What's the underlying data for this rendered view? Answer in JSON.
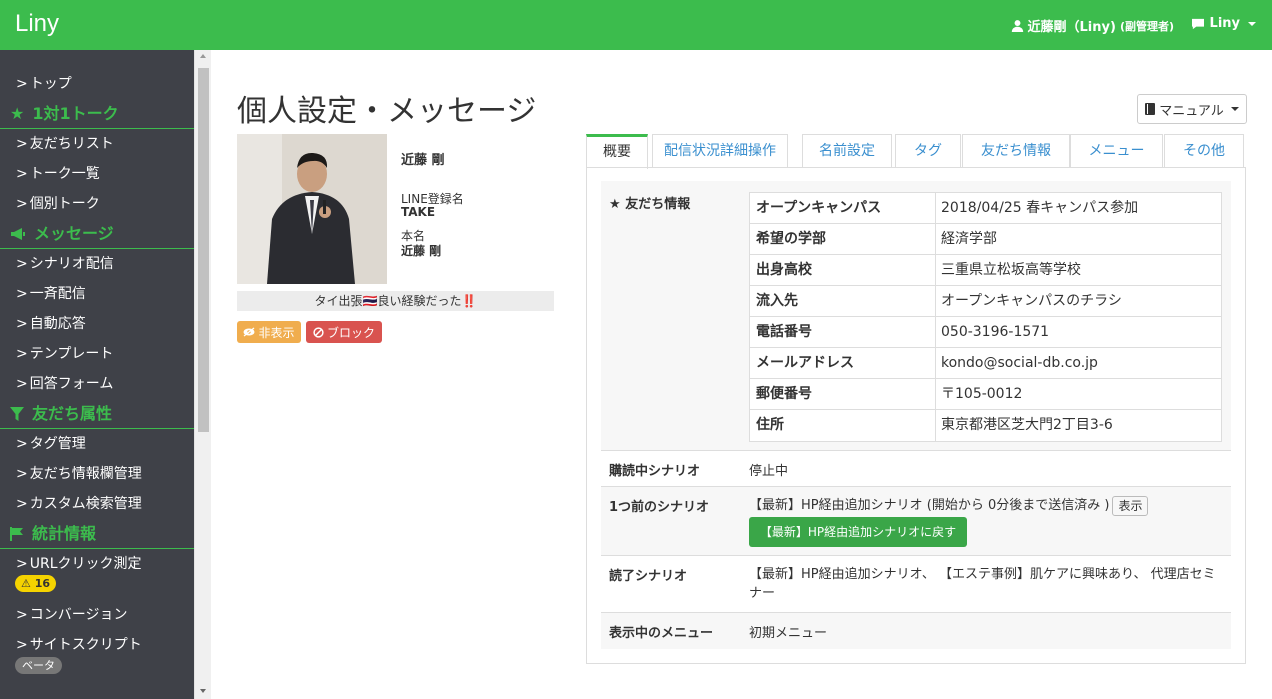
{
  "header": {
    "brand": "Liny",
    "user": "近藤剛（Liny)",
    "role": "(副管理者)",
    "menu_label": "Liny"
  },
  "sidebar": {
    "top": "トップ",
    "sections": [
      {
        "title": "1対1トーク",
        "icon": "star-icon",
        "items": [
          "友だちリスト",
          "トーク一覧",
          "個別トーク"
        ]
      },
      {
        "title": "メッセージ",
        "icon": "megaphone-icon",
        "items": [
          "シナリオ配信",
          "一斉配信",
          "自動応答",
          "テンプレート",
          "回答フォーム"
        ]
      },
      {
        "title": "友だち属性",
        "icon": "filter-icon",
        "items": [
          "タグ管理",
          "友だち情報欄管理",
          "カスタム検索管理"
        ]
      },
      {
        "title": "統計情報",
        "icon": "flag-icon",
        "items": [
          "URLクリック測定",
          "コンバージョン",
          "サイトスクリプト"
        ]
      }
    ],
    "url_badge": "16",
    "script_badge": "ベータ"
  },
  "main": {
    "title": "個人設定・メッセージ",
    "manual_label": "マニュアル"
  },
  "profile": {
    "name": "近藤 剛",
    "line_label": "LINE登録名",
    "line_name": "TAKE",
    "real_label": "本名",
    "real_name": "近藤 剛",
    "status_message": "タイ出張🇹🇭良い経験だった‼️",
    "hide_label": "非表示",
    "block_label": "ブロック"
  },
  "tabs": [
    "概要",
    "配信状況詳細操作",
    "名前設定",
    "タグ",
    "友だち情報",
    "メニュー",
    "その他"
  ],
  "details": {
    "friend_info_label": "友だち情報",
    "friend_info": [
      {
        "key": "オープンキャンパス",
        "value": "2018/04/25 春キャンパス参加"
      },
      {
        "key": "希望の学部",
        "value": "経済学部"
      },
      {
        "key": "出身高校",
        "value": "三重県立松坂高等学校"
      },
      {
        "key": "流入先",
        "value": "オープンキャンパスのチラシ"
      },
      {
        "key": "電話番号",
        "value": "050-3196-1571"
      },
      {
        "key": "メールアドレス",
        "value": "kondo@social-db.co.jp"
      },
      {
        "key": "郵便番号",
        "value": "〒105-0012"
      },
      {
        "key": "住所",
        "value": "東京都港区芝大門2丁目3-6"
      }
    ],
    "subscribing_label": "購読中シナリオ",
    "subscribing_value": "停止中",
    "prev_label": "1つ前のシナリオ",
    "prev_value": "【最新】HP経由追加シナリオ (開始から 0分後まで送信済み )",
    "prev_show": "表示",
    "prev_return": "【最新】HP経由追加シナリオに戻す",
    "read_label": "読了シナリオ",
    "read_value": "【最新】HP経由追加シナリオ、 【エステ事例】肌ケアに興味あり、 代理店セミナー",
    "menu_label": "表示中のメニュー",
    "menu_value": "初期メニュー"
  }
}
